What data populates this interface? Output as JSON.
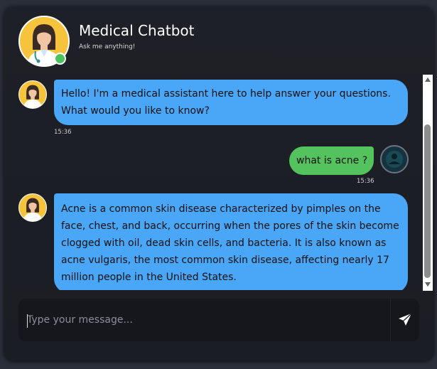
{
  "header": {
    "title": "Medical Chatbot",
    "subtitle": "Ask me anything!",
    "avatar_icon": "doctor-avatar-icon",
    "status": "online",
    "status_color": "#4cc25d"
  },
  "messages": [
    {
      "sender": "bot",
      "text": "Hello! I'm a medical assistant here to help answer your questions. What would you like to know?",
      "time": "15:36"
    },
    {
      "sender": "user",
      "text": "what is acne ?",
      "time": "15:36"
    },
    {
      "sender": "bot",
      "text": "Acne is a common skin disease characterized by pimples on the face, chest, and back, occurring when the pores of the skin become clogged with oil, dead skin cells, and bacteria. It is also known as acne vulgaris, the most common skin disease, affecting nearly 17 million people in the United States.",
      "time": ""
    }
  ],
  "composer": {
    "placeholder": "Type your message...",
    "value": "",
    "send_icon": "send-icon"
  },
  "colors": {
    "bot_bubble": "#4aa6f7",
    "user_bubble": "#54c25d",
    "background": "#1e2027",
    "avatar_bg": "#f6c33c"
  }
}
